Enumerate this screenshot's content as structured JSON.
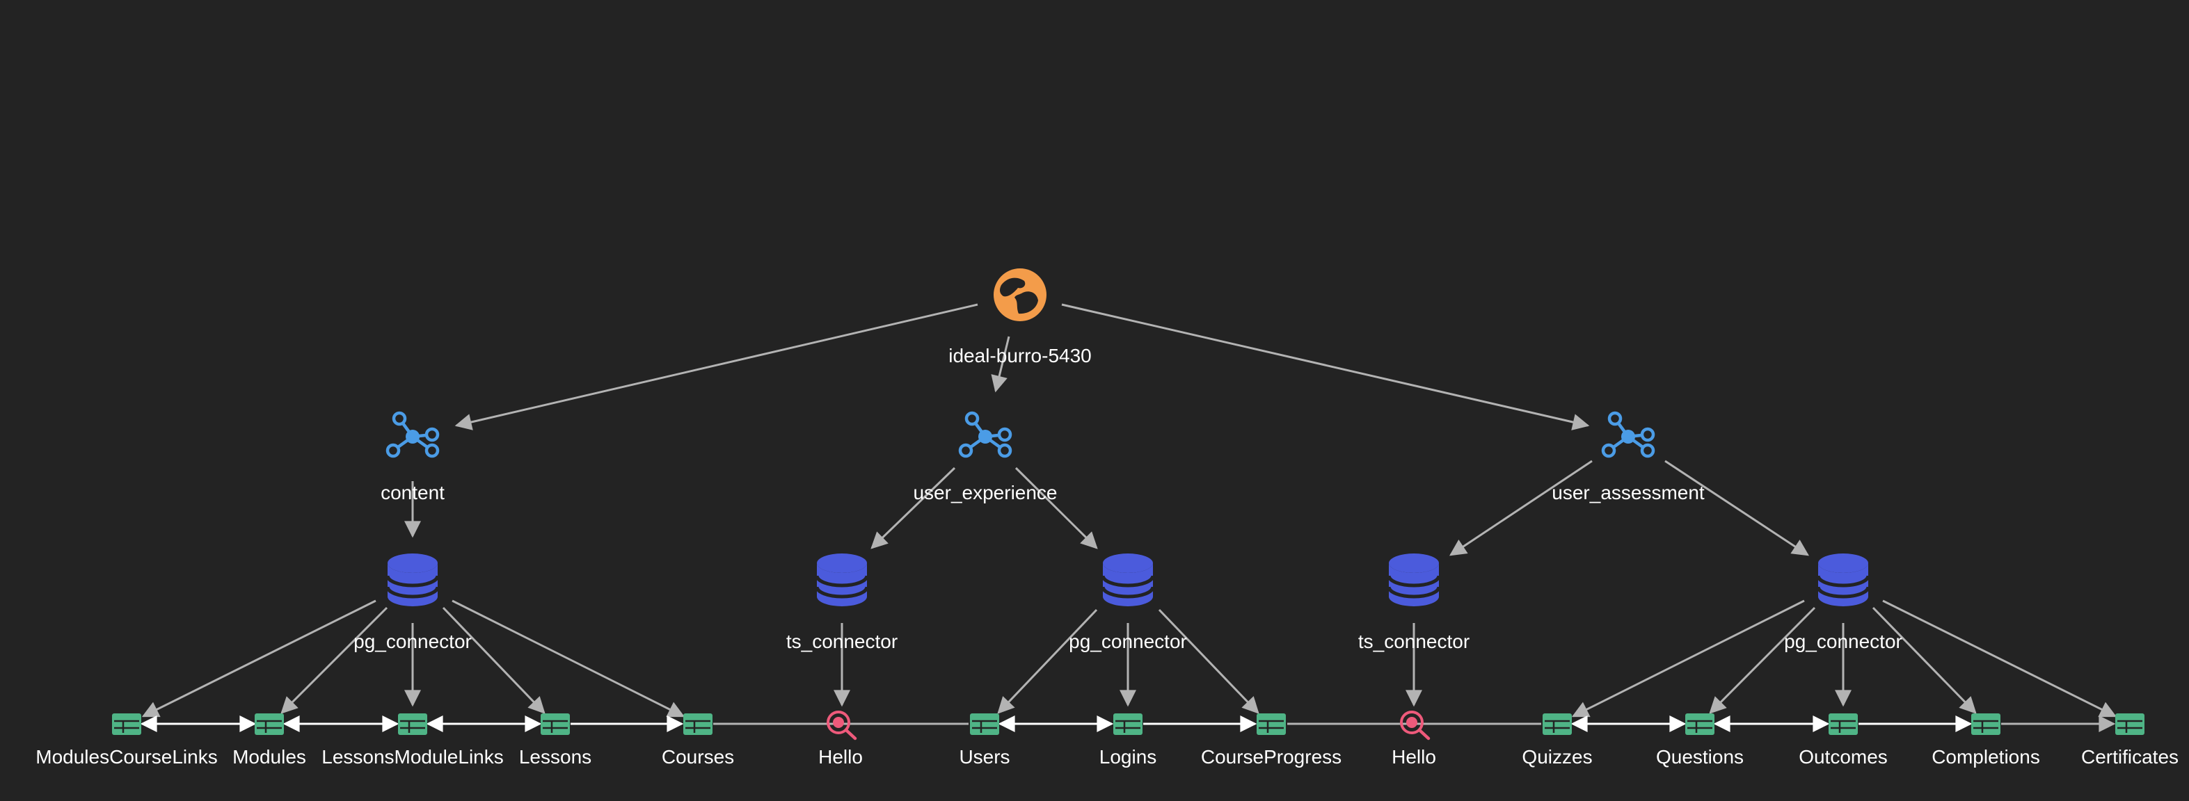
{
  "colors": {
    "background": "#232323",
    "edge": "#b3b3b3",
    "sibling_link": "#ffffff",
    "root": "#f39c4a",
    "namespace": "#4b9ce6",
    "connector": "#4b5bdc",
    "table": "#4fb486",
    "query": "#ee5a7b",
    "label": "#ffffff"
  },
  "nodes": {
    "root": {
      "label": "ideal-burro-5430",
      "icon": "globe-icon"
    },
    "ns_content": {
      "label": "content",
      "icon": "hub-icon"
    },
    "ns_ux": {
      "label": "user_experience",
      "icon": "hub-icon"
    },
    "ns_assess": {
      "label": "user_assessment",
      "icon": "hub-icon"
    },
    "pg1": {
      "label": "pg_connector",
      "icon": "database-icon"
    },
    "ts1": {
      "label": "ts_connector",
      "icon": "database-icon"
    },
    "pg2": {
      "label": "pg_connector",
      "icon": "database-icon"
    },
    "ts2": {
      "label": "ts_connector",
      "icon": "database-icon"
    },
    "pg3": {
      "label": "pg_connector",
      "icon": "database-icon"
    },
    "t_mcl": {
      "label": "ModulesCourseLinks",
      "icon": "table-icon"
    },
    "t_modules": {
      "label": "Modules",
      "icon": "table-icon"
    },
    "t_lml": {
      "label": "LessonsModuleLinks",
      "icon": "table-icon"
    },
    "t_lessons": {
      "label": "Lessons",
      "icon": "table-icon"
    },
    "t_courses": {
      "label": "Courses",
      "icon": "table-icon"
    },
    "q_hello1": {
      "label": "Hello",
      "icon": "query-icon"
    },
    "t_users": {
      "label": "Users",
      "icon": "table-icon"
    },
    "t_logins": {
      "label": "Logins",
      "icon": "table-icon"
    },
    "t_cprog": {
      "label": "CourseProgress",
      "icon": "table-icon"
    },
    "q_hello2": {
      "label": "Hello",
      "icon": "query-icon"
    },
    "t_quizzes": {
      "label": "Quizzes",
      "icon": "table-icon"
    },
    "t_questions": {
      "label": "Questions",
      "icon": "table-icon"
    },
    "t_outcomes": {
      "label": "Outcomes",
      "icon": "table-icon"
    },
    "t_completions": {
      "label": "Completions",
      "icon": "table-icon"
    },
    "t_certs": {
      "label": "Certificates",
      "icon": "table-icon"
    }
  }
}
